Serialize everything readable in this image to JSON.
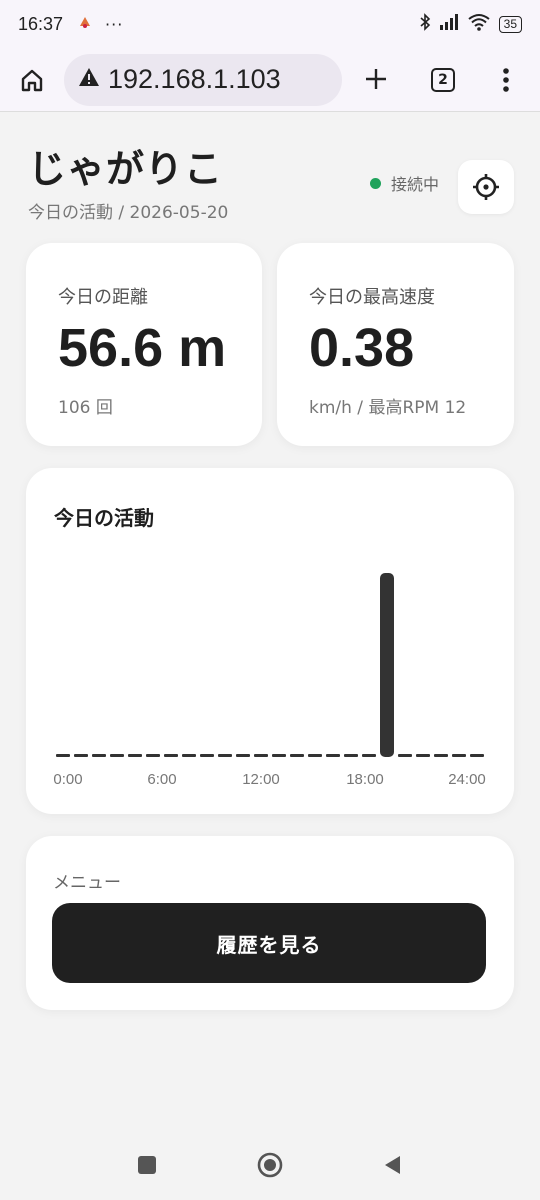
{
  "status_bar": {
    "time": "16:37",
    "more": "···",
    "battery": "35"
  },
  "browser": {
    "url": "192.168.1.103",
    "tab_count": "2"
  },
  "header": {
    "title": "じゃがりこ",
    "subtitle": "今日の活動 / 2026-05-20",
    "connection_status": "接続中",
    "connection_color": "#1fa25b"
  },
  "stats": {
    "distance": {
      "label": "今日の距離",
      "value": "56.6 m",
      "foot": "106 回"
    },
    "speed": {
      "label": "今日の最高速度",
      "value": "0.38",
      "foot": "km/h / 最高RPM 12"
    }
  },
  "activity": {
    "title": "今日の活動",
    "chart_data": {
      "type": "bar",
      "x_ticks": [
        "0:00",
        "6:00",
        "12:00",
        "18:00",
        "24:00"
      ],
      "categories": [
        "0",
        "1",
        "2",
        "3",
        "4",
        "5",
        "6",
        "7",
        "8",
        "9",
        "10",
        "11",
        "12",
        "13",
        "14",
        "15",
        "16",
        "17",
        "18",
        "19",
        "20",
        "21",
        "22",
        "23"
      ],
      "values": [
        0,
        0,
        0,
        0,
        0,
        0,
        0,
        0,
        0,
        0,
        0,
        0,
        0,
        0,
        0,
        0,
        0,
        0,
        1,
        0,
        0,
        0,
        0,
        0
      ],
      "title": "今日の活動",
      "grid": false
    }
  },
  "menu": {
    "label": "メニュー",
    "history_button": "履歴を見る"
  }
}
